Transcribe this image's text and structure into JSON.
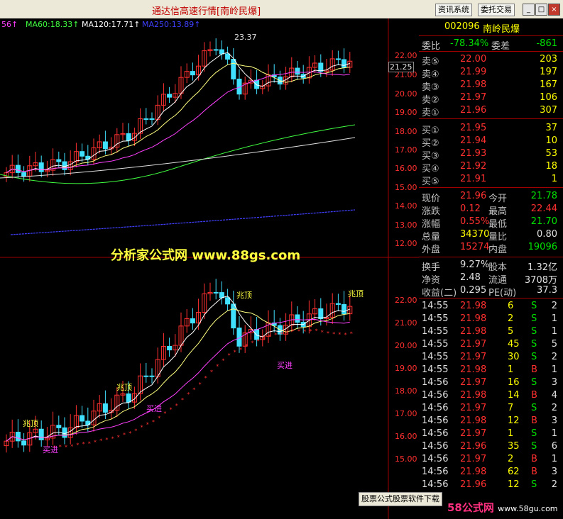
{
  "window": {
    "title": "通达信高速行情",
    "stock_tag": "[南岭民爆]",
    "btn_info": "资讯系统",
    "btn_trade": "委托交易"
  },
  "ma_legend": [
    {
      "label": "56↑",
      "color": "#ff40ff"
    },
    {
      "label": "MA60:18.33↑",
      "color": "#40ff40"
    },
    {
      "label": "MA120:17.71↑",
      "color": "#ffffff"
    },
    {
      "label": "MA250:13.89↑",
      "color": "#4040ff"
    }
  ],
  "price_label_current": "21.25",
  "peak_label": "23.37",
  "watermark": "分析家公式网 www.88gs.com",
  "signals": {
    "top": "兆顶",
    "buy": "买进"
  },
  "upper_axis": [
    "22.00",
    "21.00",
    "20.00",
    "19.00",
    "18.00",
    "17.00",
    "16.00",
    "15.00",
    "14.00",
    "13.00",
    "12.00"
  ],
  "lower_axis": [
    "22.00",
    "21.00",
    "20.00",
    "19.00",
    "18.00",
    "17.00",
    "16.00",
    "15.00"
  ],
  "quote": {
    "code": "002096",
    "name": "南岭民爆",
    "weibi_label": "委比",
    "weibi": "-78.34%",
    "weicha_label": "委差",
    "weicha": "-861",
    "asks": [
      {
        "label": "卖⑤",
        "price": "22.00",
        "vol": "203"
      },
      {
        "label": "卖④",
        "price": "21.99",
        "vol": "197"
      },
      {
        "label": "卖③",
        "price": "21.98",
        "vol": "167"
      },
      {
        "label": "卖②",
        "price": "21.97",
        "vol": "106"
      },
      {
        "label": "卖①",
        "price": "21.96",
        "vol": "307"
      }
    ],
    "bids": [
      {
        "label": "买①",
        "price": "21.95",
        "vol": "37"
      },
      {
        "label": "买②",
        "price": "21.94",
        "vol": "10"
      },
      {
        "label": "买③",
        "price": "21.93",
        "vol": "53"
      },
      {
        "label": "买④",
        "price": "21.92",
        "vol": "18"
      },
      {
        "label": "买⑤",
        "price": "21.91",
        "vol": "1"
      }
    ],
    "stats": [
      {
        "l1": "现价",
        "v1": "21.96",
        "l2": "今开",
        "v2": "21.78",
        "c2": "green"
      },
      {
        "l1": "涨跌",
        "v1": "0.12",
        "l2": "最高",
        "v2": "22.44",
        "c2": "red"
      },
      {
        "l1": "涨幅",
        "v1": "0.55%",
        "l2": "最低",
        "v2": "21.70",
        "c2": "green"
      },
      {
        "l1": "总量",
        "v1": "34370",
        "l2": "量比",
        "v2": "0.80",
        "c2": "white",
        "c1": "yellow"
      },
      {
        "l1": "外盘",
        "v1": "15274",
        "l2": "内盘",
        "v2": "19096",
        "c2": "green"
      }
    ],
    "fin": [
      {
        "l1": "换手",
        "v1": "9.27%",
        "l2": "股本",
        "v2": "1.32亿"
      },
      {
        "l1": "净资",
        "v1": "2.48",
        "l2": "流通",
        "v2": "3708万"
      },
      {
        "l1": "收益(二)",
        "v1": "0.295",
        "l2": "PE(动)",
        "v2": "37.3"
      }
    ],
    "ticks": [
      {
        "t": "14:55",
        "p": "21.98",
        "v": "6",
        "s": "S",
        "n": "2"
      },
      {
        "t": "14:55",
        "p": "21.98",
        "v": "2",
        "s": "S",
        "n": "1"
      },
      {
        "t": "14:55",
        "p": "21.98",
        "v": "5",
        "s": "S",
        "n": "1"
      },
      {
        "t": "14:55",
        "p": "21.97",
        "v": "45",
        "s": "S",
        "n": "5"
      },
      {
        "t": "14:55",
        "p": "21.97",
        "v": "30",
        "s": "S",
        "n": "2"
      },
      {
        "t": "14:55",
        "p": "21.98",
        "v": "1",
        "s": "B",
        "n": "1"
      },
      {
        "t": "14:56",
        "p": "21.97",
        "v": "16",
        "s": "S",
        "n": "3"
      },
      {
        "t": "14:56",
        "p": "21.98",
        "v": "14",
        "s": "B",
        "n": "4"
      },
      {
        "t": "14:56",
        "p": "21.97",
        "v": "7",
        "s": "S",
        "n": "2"
      },
      {
        "t": "14:56",
        "p": "21.98",
        "v": "12",
        "s": "B",
        "n": "3"
      },
      {
        "t": "14:56",
        "p": "21.97",
        "v": "1",
        "s": "S",
        "n": "1"
      },
      {
        "t": "14:56",
        "p": "21.96",
        "v": "35",
        "s": "S",
        "n": "6"
      },
      {
        "t": "14:56",
        "p": "21.97",
        "v": "2",
        "s": "B",
        "n": "1"
      },
      {
        "t": "14:56",
        "p": "21.98",
        "v": "62",
        "s": "B",
        "n": "3"
      },
      {
        "t": "14:56",
        "p": "21.96",
        "v": "12",
        "s": "S",
        "n": "2"
      }
    ]
  },
  "bottom_tag": "股票公式股票软件下载",
  "wm58": "58公式网",
  "wm58_domain": "www.58gu.com"
}
